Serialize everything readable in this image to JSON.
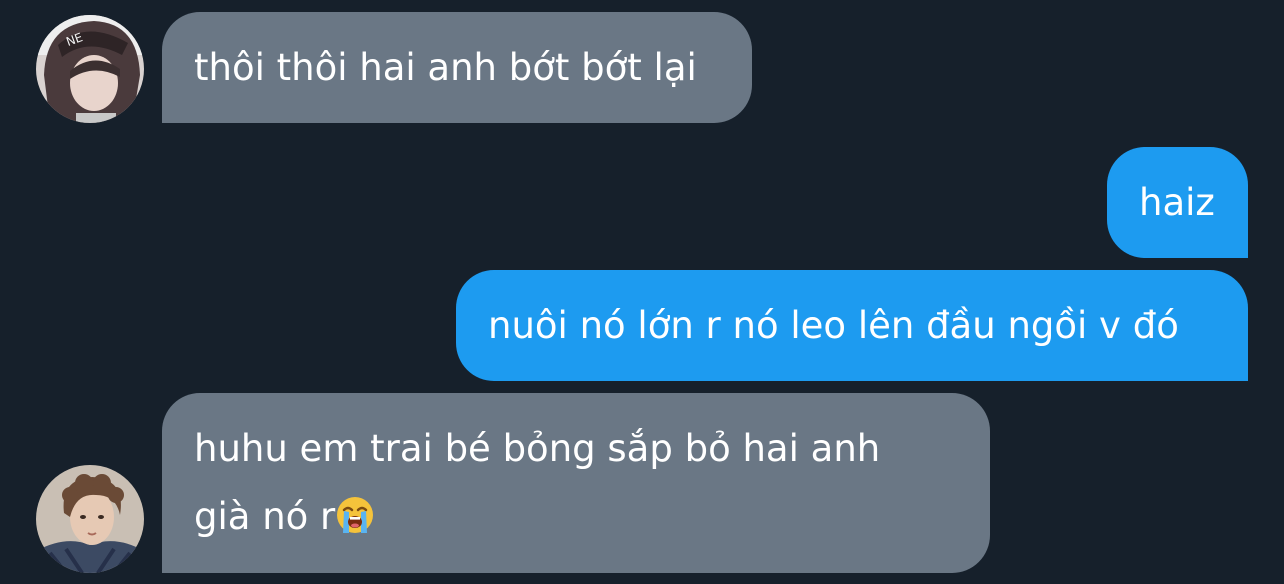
{
  "conversation": {
    "messages": [
      {
        "direction": "incoming",
        "avatar": "hooded-user-avatar",
        "lines": [
          "thôi thôi hai anh bớt bớt lại"
        ]
      },
      {
        "direction": "outgoing",
        "lines": [
          "haiz"
        ]
      },
      {
        "direction": "outgoing",
        "lines": [
          "nuôi nó lớn r nó leo lên đầu ngồi v đó"
        ]
      },
      {
        "direction": "incoming",
        "avatar": "curly-hair-user-avatar",
        "lines": [
          "huhu em trai bé bỏng sắp bỏ hai anh",
          "già nó r"
        ],
        "trailing_emoji": "loudly-crying-face"
      }
    ]
  },
  "colors": {
    "background": "#16202b",
    "incoming_bubble": "#6a7785",
    "outgoing_bubble": "#1d9bf0",
    "text": "#ffffff"
  }
}
